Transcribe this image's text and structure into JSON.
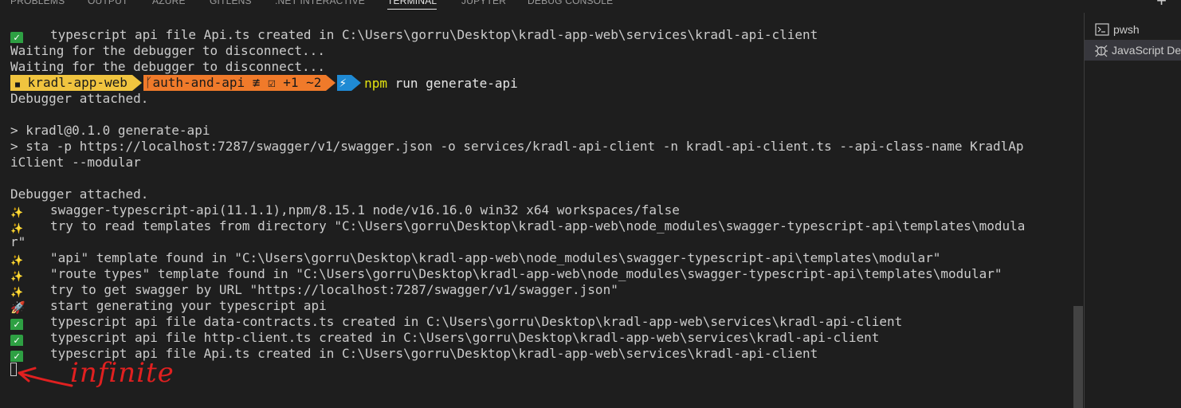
{
  "tabs": [
    {
      "label": "PROBLEMS",
      "active": false
    },
    {
      "label": "OUTPUT",
      "active": false
    },
    {
      "label": "AZURE",
      "active": false
    },
    {
      "label": "GITLENS",
      "active": false
    },
    {
      ".net": "",
      "label": ".NET INTERACTIVE",
      "active": false
    },
    {
      "label": "TERMINAL",
      "active": true
    },
    {
      "label": "JUPYTER",
      "active": false
    },
    {
      "label": "DEBUG CONSOLE",
      "active": false
    }
  ],
  "tab_actions": {
    "new_terminal": "+"
  },
  "terminal": {
    "line1": "typescript api file Api.ts created in C:\\Users\\gorru\\Desktop\\kradl-app-web\\services\\kradl-api-client",
    "line2": "Waiting for the debugger to disconnect...",
    "line3": "Waiting for the debugger to disconnect...",
    "prompt": {
      "folder": "kradl-app-web",
      "branch": "auth-and-api ≢ ☑ +1 ~2",
      "bolt": "⚡",
      "cmd_npm": "npm",
      "cmd_rest": " run generate-api"
    },
    "line5": "Debugger attached.",
    "line6": "",
    "line7": "> kradl@0.1.0 generate-api",
    "line8": "> sta -p https://localhost:7287/swagger/v1/swagger.json -o services/kradl-api-client -n kradl-api-client.ts --api-class-name KradlAp",
    "line9": "iClient --modular",
    "line10": "",
    "line11": "Debugger attached.",
    "line12": "swagger-typescript-api(11.1.1),npm/8.15.1 node/v16.16.0 win32 x64 workspaces/false",
    "line13": "try to read templates from directory \"C:\\Users\\gorru\\Desktop\\kradl-app-web\\node_modules\\swagger-typescript-api\\templates\\modula",
    "line14": "r\"",
    "line15": "\"api\" template found in \"C:\\Users\\gorru\\Desktop\\kradl-app-web\\node_modules\\swagger-typescript-api\\templates\\modular\"",
    "line16": "\"route types\" template found in \"C:\\Users\\gorru\\Desktop\\kradl-app-web\\node_modules\\swagger-typescript-api\\templates\\modular\"",
    "line17": "try to get swagger by URL \"https://localhost:7287/swagger/v1/swagger.json\"",
    "line18": "start generating your typescript api",
    "line19": "typescript api file data-contracts.ts created in C:\\Users\\gorru\\Desktop\\kradl-app-web\\services\\kradl-api-client",
    "line20": "typescript api file http-client.ts created in C:\\Users\\gorru\\Desktop\\kradl-app-web\\services\\kradl-api-client",
    "line21": "typescript api file Api.ts created in C:\\Users\\gorru\\Desktop\\kradl-app-web\\services\\kradl-api-client"
  },
  "icons": {
    "check": "✓",
    "spark": "✨",
    "rocket": "🚀",
    "folder": "▀"
  },
  "side_panel": {
    "items": [
      {
        "label": "pwsh",
        "icon": "terminal-icon",
        "selected": false
      },
      {
        "label": "JavaScript Debug Terminal",
        "icon": "debug-icon",
        "selected": true
      }
    ]
  },
  "annotation": {
    "text": "infinite",
    "color": "#e02020"
  },
  "colors": {
    "background": "#1e1e1e",
    "prompt_folder": "#f0c43f",
    "prompt_branch": "#f07a2a",
    "prompt_bolt": "#1f8ad4",
    "check": "#2ea043"
  }
}
